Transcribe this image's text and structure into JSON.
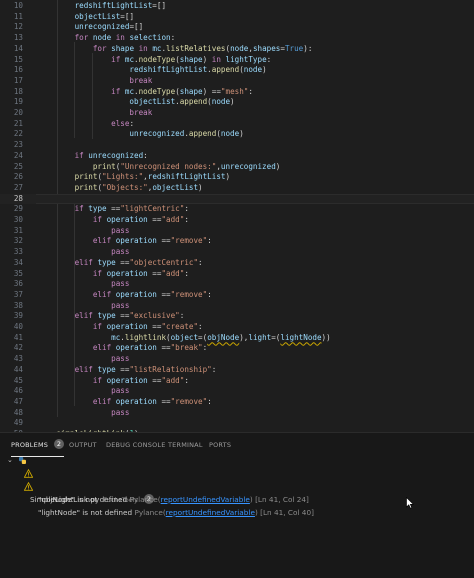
{
  "editor": {
    "lines": [
      {
        "n": "10",
        "t": [
          [
            "v",
            "        redshiftLightList"
          ],
          [
            "p",
            "=[]"
          ]
        ]
      },
      {
        "n": "11",
        "t": [
          [
            "v",
            "        objectList"
          ],
          [
            "p",
            "=[]"
          ]
        ]
      },
      {
        "n": "12",
        "t": [
          [
            "v",
            "        unrecognized"
          ],
          [
            "p",
            "=[]"
          ]
        ]
      },
      {
        "n": "13",
        "t": [
          [
            "k",
            "        for "
          ],
          [
            "v",
            "node "
          ],
          [
            "k",
            "in "
          ],
          [
            "v",
            "selection"
          ],
          [
            "p",
            ":"
          ]
        ]
      },
      {
        "n": "14",
        "t": [
          [
            "k",
            "            for "
          ],
          [
            "v",
            "shape "
          ],
          [
            "k",
            "in "
          ],
          [
            "v",
            "mc"
          ],
          [
            "p",
            "."
          ],
          [
            "f",
            "listRelatives"
          ],
          [
            "p",
            "("
          ],
          [
            "v",
            "node"
          ],
          [
            "p",
            ","
          ],
          [
            "v",
            "shapes"
          ],
          [
            "p",
            "="
          ],
          [
            "b",
            "True"
          ],
          [
            "p",
            "):"
          ]
        ]
      },
      {
        "n": "15",
        "t": [
          [
            "k",
            "                if "
          ],
          [
            "v",
            "mc"
          ],
          [
            "p",
            "."
          ],
          [
            "f",
            "nodeType"
          ],
          [
            "p",
            "("
          ],
          [
            "v",
            "shape"
          ],
          [
            "p",
            ") "
          ],
          [
            "k",
            "in "
          ],
          [
            "v",
            "lightType"
          ],
          [
            "p",
            ":"
          ]
        ]
      },
      {
        "n": "16",
        "t": [
          [
            "v",
            "                    redshiftLightList"
          ],
          [
            "p",
            "."
          ],
          [
            "f",
            "append"
          ],
          [
            "p",
            "("
          ],
          [
            "v",
            "node"
          ],
          [
            "p",
            ")"
          ]
        ]
      },
      {
        "n": "17",
        "t": [
          [
            "k",
            "                    break"
          ]
        ]
      },
      {
        "n": "18",
        "t": [
          [
            "k",
            "                if "
          ],
          [
            "v",
            "mc"
          ],
          [
            "p",
            "."
          ],
          [
            "f",
            "nodeType"
          ],
          [
            "p",
            "("
          ],
          [
            "v",
            "shape"
          ],
          [
            "p",
            ") =="
          ],
          [
            "s",
            "\"mesh\""
          ],
          [
            "p",
            ":"
          ]
        ]
      },
      {
        "n": "19",
        "t": [
          [
            "v",
            "                    objectList"
          ],
          [
            "p",
            "."
          ],
          [
            "f",
            "append"
          ],
          [
            "p",
            "("
          ],
          [
            "v",
            "node"
          ],
          [
            "p",
            ")"
          ]
        ]
      },
      {
        "n": "20",
        "t": [
          [
            "k",
            "                    break"
          ]
        ]
      },
      {
        "n": "21",
        "t": [
          [
            "k",
            "                else"
          ],
          [
            "p",
            ":"
          ]
        ]
      },
      {
        "n": "22",
        "t": [
          [
            "v",
            "                    unrecognized"
          ],
          [
            "p",
            "."
          ],
          [
            "f",
            "append"
          ],
          [
            "p",
            "("
          ],
          [
            "v",
            "node"
          ],
          [
            "p",
            ")"
          ]
        ]
      },
      {
        "n": "23",
        "t": []
      },
      {
        "n": "24",
        "t": [
          [
            "k",
            "        if "
          ],
          [
            "v",
            "unrecognized"
          ],
          [
            "p",
            ":"
          ]
        ]
      },
      {
        "n": "25",
        "t": [
          [
            "f",
            "            print"
          ],
          [
            "p",
            "("
          ],
          [
            "s",
            "\"Unrecognized nodes:\""
          ],
          [
            "p",
            ","
          ],
          [
            "v",
            "unrecognized"
          ],
          [
            "p",
            ")"
          ]
        ]
      },
      {
        "n": "26",
        "t": [
          [
            "f",
            "        print"
          ],
          [
            "p",
            "("
          ],
          [
            "s",
            "\"Lights:\""
          ],
          [
            "p",
            ","
          ],
          [
            "v",
            "redshiftLightList"
          ],
          [
            "p",
            ")"
          ]
        ]
      },
      {
        "n": "27",
        "t": [
          [
            "f",
            "        print"
          ],
          [
            "p",
            "("
          ],
          [
            "s",
            "\"Objects:\""
          ],
          [
            "p",
            ","
          ],
          [
            "v",
            "objectList"
          ],
          [
            "p",
            ")"
          ]
        ]
      },
      {
        "n": "28",
        "t": [],
        "active": true
      },
      {
        "n": "29",
        "t": [
          [
            "k",
            "        if "
          ],
          [
            "v",
            "type "
          ],
          [
            "p",
            "=="
          ],
          [
            "s",
            "\"lightCentric\""
          ],
          [
            "p",
            ":"
          ]
        ]
      },
      {
        "n": "30",
        "t": [
          [
            "k",
            "            if "
          ],
          [
            "v",
            "operation "
          ],
          [
            "p",
            "=="
          ],
          [
            "s",
            "\"add\""
          ],
          [
            "p",
            ":"
          ]
        ]
      },
      {
        "n": "31",
        "t": [
          [
            "k",
            "                pass"
          ]
        ]
      },
      {
        "n": "32",
        "t": [
          [
            "k",
            "            elif "
          ],
          [
            "v",
            "operation "
          ],
          [
            "p",
            "=="
          ],
          [
            "s",
            "\"remove\""
          ],
          [
            "p",
            ":"
          ]
        ]
      },
      {
        "n": "33",
        "t": [
          [
            "k",
            "                pass"
          ]
        ]
      },
      {
        "n": "34",
        "t": [
          [
            "k",
            "        elif "
          ],
          [
            "v",
            "type "
          ],
          [
            "p",
            "=="
          ],
          [
            "s",
            "\"objectCentric\""
          ],
          [
            "p",
            ":"
          ]
        ]
      },
      {
        "n": "35",
        "t": [
          [
            "k",
            "            if "
          ],
          [
            "v",
            "operation "
          ],
          [
            "p",
            "=="
          ],
          [
            "s",
            "\"add\""
          ],
          [
            "p",
            ":"
          ]
        ]
      },
      {
        "n": "36",
        "t": [
          [
            "k",
            "                pass"
          ]
        ]
      },
      {
        "n": "37",
        "t": [
          [
            "k",
            "            elif "
          ],
          [
            "v",
            "operation "
          ],
          [
            "p",
            "=="
          ],
          [
            "s",
            "\"remove\""
          ],
          [
            "p",
            ":"
          ]
        ]
      },
      {
        "n": "38",
        "t": [
          [
            "k",
            "                pass"
          ]
        ]
      },
      {
        "n": "39",
        "t": [
          [
            "k",
            "        elif "
          ],
          [
            "v",
            "type "
          ],
          [
            "p",
            "=="
          ],
          [
            "s",
            "\"exclusive\""
          ],
          [
            "p",
            ":"
          ]
        ]
      },
      {
        "n": "40",
        "t": [
          [
            "k",
            "            if "
          ],
          [
            "v",
            "operation "
          ],
          [
            "p",
            "=="
          ],
          [
            "s",
            "\"create\""
          ],
          [
            "p",
            ":"
          ]
        ]
      },
      {
        "n": "41",
        "t": [
          [
            "v",
            "                mc"
          ],
          [
            "p",
            "."
          ],
          [
            "f",
            "lightlink"
          ],
          [
            "p",
            "("
          ],
          [
            "v",
            "object"
          ],
          [
            "p",
            "=("
          ],
          [
            "u",
            "objNode"
          ],
          [
            "p",
            "),"
          ],
          [
            "v",
            "light"
          ],
          [
            "p",
            "=("
          ],
          [
            "u",
            "lightNode"
          ],
          [
            "p",
            "))"
          ]
        ]
      },
      {
        "n": "42",
        "t": [
          [
            "k",
            "            elif "
          ],
          [
            "v",
            "operation "
          ],
          [
            "p",
            "=="
          ],
          [
            "s",
            "\"break\""
          ],
          [
            "p",
            ":"
          ]
        ]
      },
      {
        "n": "43",
        "t": [
          [
            "k",
            "                pass"
          ]
        ]
      },
      {
        "n": "44",
        "t": [
          [
            "k",
            "        elif "
          ],
          [
            "v",
            "type "
          ],
          [
            "p",
            "=="
          ],
          [
            "s",
            "\"listRelationship\""
          ],
          [
            "p",
            ":"
          ]
        ]
      },
      {
        "n": "45",
        "t": [
          [
            "k",
            "            if "
          ],
          [
            "v",
            "operation "
          ],
          [
            "p",
            "=="
          ],
          [
            "s",
            "\"add\""
          ],
          [
            "p",
            ":"
          ]
        ]
      },
      {
        "n": "46",
        "t": [
          [
            "k",
            "                pass"
          ]
        ]
      },
      {
        "n": "47",
        "t": [
          [
            "k",
            "            elif "
          ],
          [
            "v",
            "operation "
          ],
          [
            "p",
            "=="
          ],
          [
            "s",
            "\"remove\""
          ],
          [
            "p",
            ":"
          ]
        ]
      },
      {
        "n": "48",
        "t": [
          [
            "k",
            "                pass"
          ]
        ]
      },
      {
        "n": "49",
        "t": []
      },
      {
        "n": "50",
        "t": [
          [
            "f",
            "    simpleLightLink"
          ],
          [
            "p",
            "("
          ],
          [
            "c",
            "1"
          ],
          [
            "p",
            ")"
          ]
        ]
      }
    ]
  },
  "panel": {
    "tabs": [
      {
        "label": "Problems",
        "badge": "2",
        "active": true
      },
      {
        "label": "Output"
      },
      {
        "label": "Debug Console"
      },
      {
        "label": "Terminal"
      },
      {
        "label": "Ports"
      }
    ],
    "file": {
      "name": "SimpleLightLink.py",
      "dir": "FuchsTools",
      "count": "2"
    },
    "problems": [
      {
        "message": "\"objNode\" is not defined",
        "source": "Pylance",
        "rule": "reportUndefinedVariable",
        "loc": "[Ln 41, Col 24]"
      },
      {
        "message": "\"lightNode\" is not defined",
        "source": "Pylance",
        "rule": "reportUndefinedVariable",
        "loc": "[Ln 41, Col 40]"
      }
    ]
  },
  "colors": {
    "keyword": "#c586c0",
    "builtin": "#569cd6",
    "function": "#dcdcaa",
    "string": "#ce9178",
    "variable": "#9cdcfe",
    "number": "#4ec9b0",
    "warning": "#cca700",
    "link": "#3794ff"
  },
  "icons": [
    "chevron-down-icon",
    "python-file-icon",
    "warning-icon",
    "mouse-pointer-icon"
  ]
}
